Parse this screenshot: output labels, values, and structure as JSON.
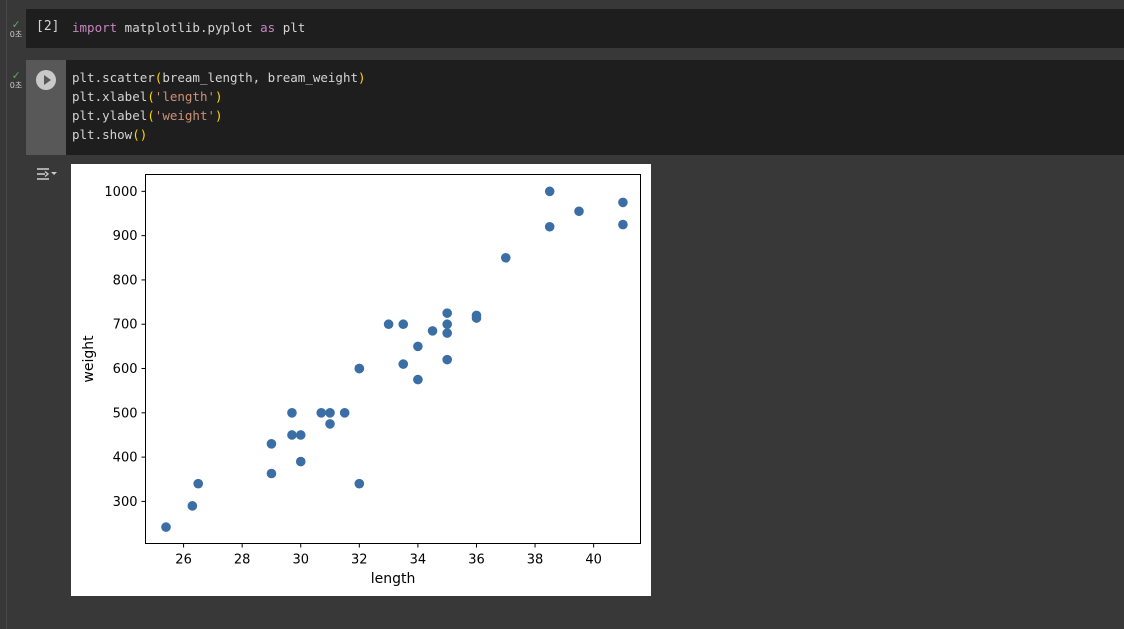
{
  "cells": [
    {
      "exec_count": "[2]",
      "status_time": "0초",
      "code": {
        "kw1": "import",
        "mod": " matplotlib.pyplot ",
        "kw2": "as",
        "alias": " plt"
      }
    },
    {
      "status_time": "0초",
      "lines": [
        {
          "pre": "plt.scatter",
          "open": "(",
          "args": "bream_length, bream_weight",
          "close": ")"
        },
        {
          "pre": "plt.xlabel",
          "open": "(",
          "args": "'length'",
          "close": ")"
        },
        {
          "pre": "plt.ylabel",
          "open": "(",
          "args": "'weight'",
          "close": ")"
        },
        {
          "pre": "plt.show",
          "open": "(",
          "args": "",
          "close": ")"
        }
      ]
    }
  ],
  "icons": {
    "status": "check-icon",
    "run": "play-icon",
    "output": "output-settings-icon"
  },
  "colors": {
    "point": "#3a6ea5",
    "check": "#57b557"
  },
  "chart_data": {
    "type": "scatter",
    "xlabel": "length",
    "ylabel": "weight",
    "xlim": [
      24.7,
      41.6
    ],
    "ylim": [
      205,
      1038
    ],
    "xticks": [
      26,
      28,
      30,
      32,
      34,
      36,
      38,
      40
    ],
    "yticks": [
      300,
      400,
      500,
      600,
      700,
      800,
      900,
      1000
    ],
    "x": [
      25.4,
      26.3,
      26.5,
      29.0,
      29.0,
      29.7,
      29.7,
      30.0,
      30.0,
      30.7,
      31.0,
      31.0,
      31.5,
      32.0,
      32.0,
      32.0,
      33.0,
      33.5,
      33.5,
      34.0,
      34.0,
      34.5,
      35.0,
      35.0,
      35.0,
      35.0,
      36.0,
      36.0,
      37.0,
      38.5,
      38.5,
      39.5,
      41.0,
      41.0
    ],
    "y": [
      242,
      290,
      340,
      363,
      430,
      450,
      500,
      390,
      450,
      500,
      475,
      500,
      500,
      340,
      600,
      600,
      700,
      700,
      610,
      650,
      575,
      685,
      620,
      680,
      700,
      725,
      720,
      714,
      850,
      1000,
      920,
      955,
      925,
      975,
      950
    ]
  }
}
